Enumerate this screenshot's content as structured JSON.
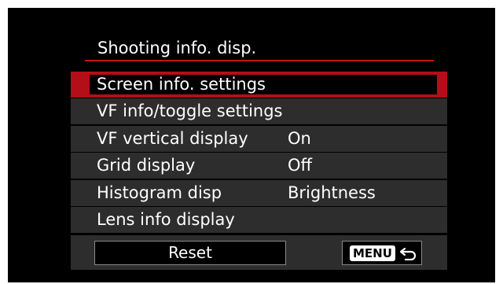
{
  "header": {
    "title": "Shooting info. disp."
  },
  "menu": {
    "items": [
      {
        "label": "Screen info. settings",
        "value": ""
      },
      {
        "label": "VF info/toggle settings",
        "value": ""
      },
      {
        "label": "VF vertical display",
        "value": "On"
      },
      {
        "label": "Grid display",
        "value": "Off"
      },
      {
        "label": "Histogram disp",
        "value": "Brightness"
      },
      {
        "label": "Lens info display",
        "value": ""
      }
    ],
    "selected_index": 0
  },
  "footer": {
    "reset_label": "Reset",
    "menu_label": "MENU",
    "back_icon": "return-arrow-icon"
  },
  "colors": {
    "accent": "#b40e18",
    "row_background": "#2d2d2d",
    "screen_background": "#000000"
  }
}
